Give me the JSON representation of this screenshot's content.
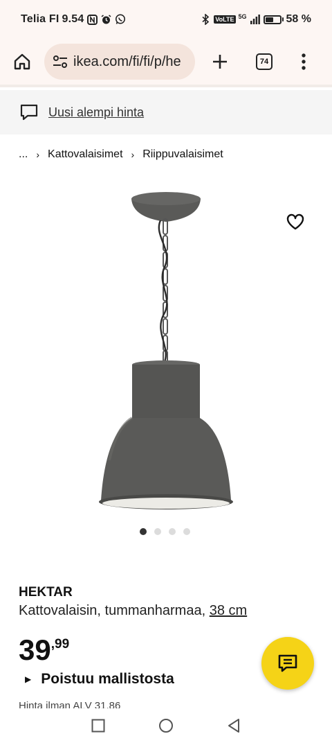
{
  "status_bar": {
    "carrier": "Telia FI",
    "time": "9.54",
    "network": "VoLTE",
    "signal_label": "5G",
    "battery": "58 %",
    "battery_level": 0.58
  },
  "browser": {
    "url": "ikea.com/fi/fi/p/he",
    "tab_count": "74"
  },
  "notice": {
    "text": "Uusi alempi hinta"
  },
  "breadcrumb": {
    "items": [
      "...",
      "Kattovalaisimet",
      "Riippuvalaisimet"
    ]
  },
  "carousel": {
    "total": 4,
    "active_index": 0
  },
  "product": {
    "name": "HEKTAR",
    "description": "Kattovalaisin, tummanharmaa,",
    "size": "38 cm",
    "price_int": "39",
    "price_dec": ",99",
    "status": "Poistuu mallistosta",
    "vat_text": "Hinta ilman ALV 31,86"
  },
  "colors": {
    "brand_yellow": "#f5d317",
    "browser_bg": "#fdf6f3",
    "url_bg": "#f4e4dc",
    "lamp_gray": "#555553"
  }
}
